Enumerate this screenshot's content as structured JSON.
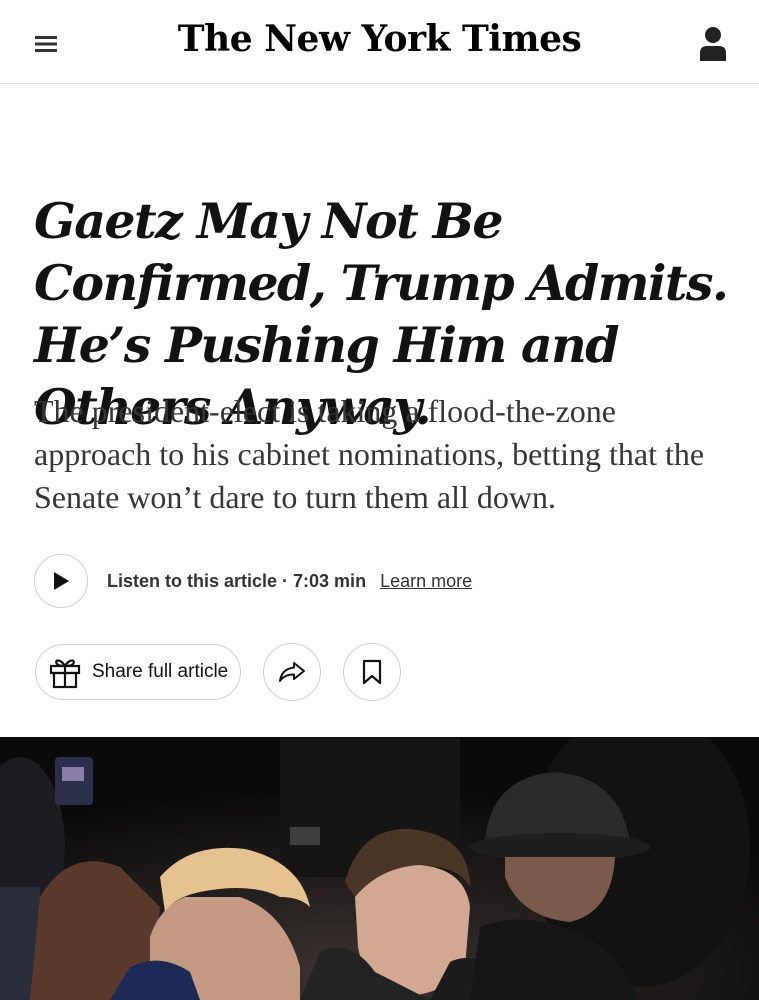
{
  "header": {
    "logo_text": "The New York Times",
    "menu_icon": "hamburger-menu-icon",
    "account_icon": "person-icon"
  },
  "article": {
    "headline": "Gaetz May Not Be Confirmed, Trump Admits. He’s Pushing Him and Others Anyway.",
    "summary": "The president-elect is taking a flood-the-zone approach to his cabinet nominations, betting that the Senate won’t dare to turn them all down."
  },
  "audio": {
    "play_icon": "play-icon",
    "listen_label": "Listen to this article · 7:03 min",
    "learn_more": "Learn more"
  },
  "actions": {
    "share_full_label": "Share full article",
    "gift_icon": "gift-icon",
    "share_icon": "share-arrow-icon",
    "save_icon": "bookmark-icon"
  },
  "colors": {
    "text": "#121212",
    "summary_text": "#363636",
    "border": "#cfcfcf",
    "divider": "#dfdfdf"
  }
}
